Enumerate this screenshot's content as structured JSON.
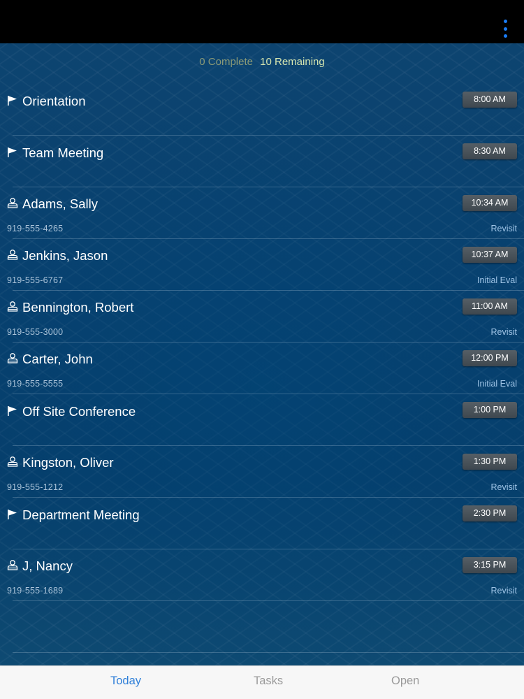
{
  "summary": {
    "complete": "0 Complete",
    "remaining": "10 Remaining"
  },
  "colors": {
    "accent": "#2f7fd8",
    "menu_dots": "#1a7cf5"
  },
  "items": [
    {
      "kind": "task",
      "icon": "flag-icon",
      "title": "Orientation",
      "time": "8:00 AM",
      "phone": "",
      "visit_type": ""
    },
    {
      "kind": "task",
      "icon": "flag-icon",
      "title": "Team Meeting",
      "time": "8:30 AM",
      "phone": "",
      "visit_type": ""
    },
    {
      "kind": "patient",
      "icon": "person-icon",
      "title": "Adams, Sally",
      "time": "10:34 AM",
      "phone": "919-555-4265",
      "visit_type": "Revisit"
    },
    {
      "kind": "patient",
      "icon": "person-icon",
      "title": "Jenkins, Jason",
      "time": "10:37 AM",
      "phone": "919-555-6767",
      "visit_type": "Initial Eval"
    },
    {
      "kind": "patient",
      "icon": "person-icon",
      "title": "Bennington, Robert",
      "time": "11:00 AM",
      "phone": "919-555-3000",
      "visit_type": "Revisit"
    },
    {
      "kind": "patient",
      "icon": "person-icon",
      "title": "Carter, John",
      "time": "12:00 PM",
      "phone": "919-555-5555",
      "visit_type": "Initial Eval"
    },
    {
      "kind": "task",
      "icon": "flag-icon",
      "title": "Off Site Conference",
      "time": "1:00 PM",
      "phone": "",
      "visit_type": ""
    },
    {
      "kind": "patient",
      "icon": "person-icon",
      "title": "Kingston, Oliver",
      "time": "1:30 PM",
      "phone": "919-555-1212",
      "visit_type": "Revisit"
    },
    {
      "kind": "task",
      "icon": "flag-icon",
      "title": "Department Meeting",
      "time": "2:30 PM",
      "phone": "",
      "visit_type": ""
    },
    {
      "kind": "patient",
      "icon": "person-icon",
      "title": "J, Nancy",
      "time": "3:15 PM",
      "phone": "919-555-1689",
      "visit_type": "Revisit"
    }
  ],
  "tabs": [
    {
      "label": "Today",
      "active": true
    },
    {
      "label": "Tasks",
      "active": false
    },
    {
      "label": "Open",
      "active": false
    }
  ]
}
